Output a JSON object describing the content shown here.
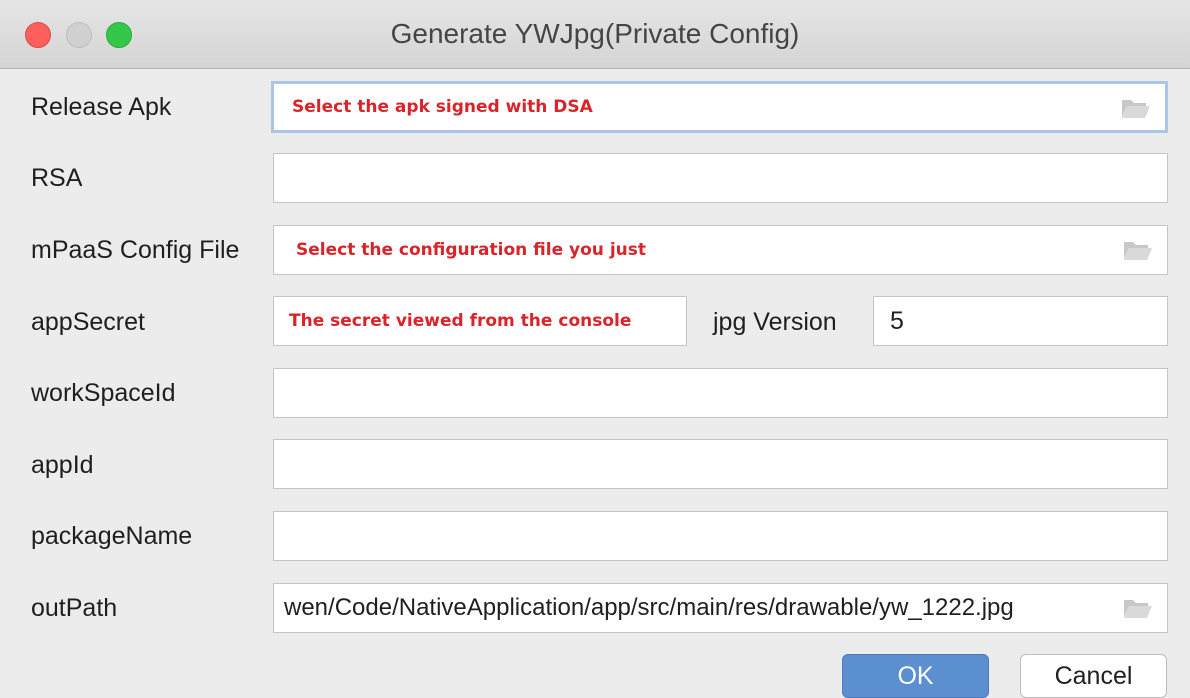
{
  "window": {
    "title": "Generate YWJpg(Private Config)"
  },
  "form": {
    "release_apk": {
      "label": "Release Apk",
      "hint": "Select the apk signed with DSA",
      "value": ""
    },
    "rsa": {
      "label": "RSA",
      "value": ""
    },
    "mpaas_config": {
      "label": "mPaaS Config File",
      "hint": "Select the configuration file you just",
      "value": ""
    },
    "app_secret": {
      "label": "appSecret",
      "hint": "The secret viewed from the console",
      "value": ""
    },
    "jpg_version": {
      "label": "jpg Version",
      "value": "5"
    },
    "workspace_id": {
      "label": "workSpaceId",
      "value": ""
    },
    "app_id": {
      "label": "appId",
      "value": ""
    },
    "package_name": {
      "label": "packageName",
      "value": ""
    },
    "out_path": {
      "label": "outPath",
      "value": "wen/Code/NativeApplication/app/src/main/res/drawable/yw_1222.jpg"
    }
  },
  "buttons": {
    "ok": "OK",
    "cancel": "Cancel"
  },
  "colors": {
    "hint": "#d9242a",
    "ok_button": "#5b8fd0",
    "focus_ring": "#a9c6e8",
    "close": "#fc605c",
    "maximize": "#34c84a"
  }
}
